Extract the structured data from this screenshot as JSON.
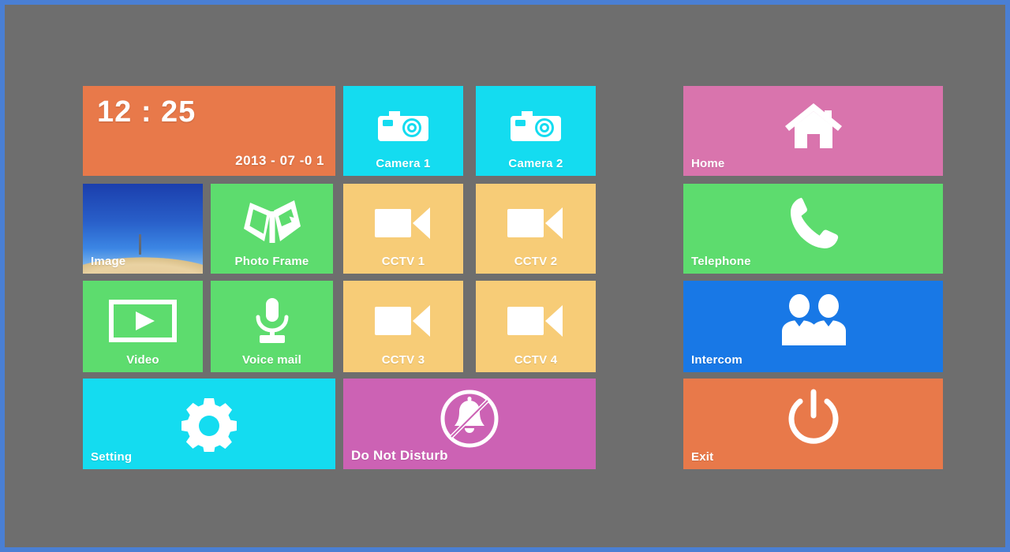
{
  "device": {
    "bezel_color": "#4a7fd4",
    "screen_bg": "#6e6e6e"
  },
  "clock": {
    "time": "12 : 25",
    "date": "2013 - 07 -0 1",
    "color": "#e8794a"
  },
  "left_panel": {
    "tiles": [
      {
        "id": "camera-1",
        "label": "Camera 1",
        "icon": "photo-camera-icon",
        "color": "#14dcf0",
        "label_pos": "center"
      },
      {
        "id": "camera-2",
        "label": "Camera 2",
        "icon": "photo-camera-icon",
        "color": "#14dcf0",
        "label_pos": "center"
      },
      {
        "id": "image",
        "label": "Image",
        "icon": "photo-thumbnail",
        "color": "#2b5fc4",
        "label_pos": "bottom-left"
      },
      {
        "id": "photo-frame",
        "label": "Photo Frame",
        "icon": "photo-frame-icon",
        "color": "#5ddc6e",
        "label_pos": "center"
      },
      {
        "id": "cctv-1",
        "label": "CCTV 1",
        "icon": "video-camera-icon",
        "color": "#f7cc77",
        "label_pos": "center"
      },
      {
        "id": "cctv-2",
        "label": "CCTV 2",
        "icon": "video-camera-icon",
        "color": "#f7cc77",
        "label_pos": "center"
      },
      {
        "id": "video",
        "label": "Video",
        "icon": "play-in-frame-icon",
        "color": "#5ddc6e",
        "label_pos": "center"
      },
      {
        "id": "voice-mail",
        "label": "Voice mail",
        "icon": "microphone-icon",
        "color": "#5ddc6e",
        "label_pos": "center"
      },
      {
        "id": "cctv-3",
        "label": "CCTV 3",
        "icon": "video-camera-icon",
        "color": "#f7cc77",
        "label_pos": "center"
      },
      {
        "id": "cctv-4",
        "label": "CCTV 4",
        "icon": "video-camera-icon",
        "color": "#f7cc77",
        "label_pos": "center"
      },
      {
        "id": "setting",
        "label": "Setting",
        "icon": "gear-icon",
        "color": "#14dcf0",
        "label_pos": "bottom-left"
      },
      {
        "id": "do-not-disturb",
        "label": "Do Not Disturb",
        "icon": "bell-off-icon",
        "color": "#cc62b4",
        "label_pos": "bottom-left"
      }
    ]
  },
  "right_panel": {
    "tiles": [
      {
        "id": "home",
        "label": "Home",
        "icon": "house-icon",
        "color": "#d974ad"
      },
      {
        "id": "telephone",
        "label": "Telephone",
        "icon": "phone-icon",
        "color": "#5ddc6e"
      },
      {
        "id": "intercom",
        "label": "Intercom",
        "icon": "two-people-icon",
        "color": "#1878e6"
      },
      {
        "id": "exit",
        "label": "Exit",
        "icon": "power-icon",
        "color": "#e8794a"
      }
    ]
  }
}
